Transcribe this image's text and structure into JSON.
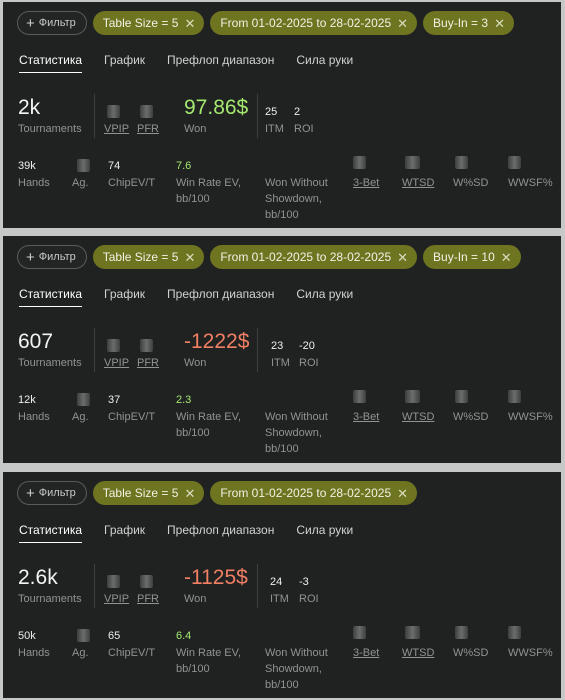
{
  "panels": [
    {
      "filter_label": "Фильтр",
      "chips": [
        "Table Size = 5",
        "From 01-02-2025 to 28-02-2025",
        "Buy-In = 3"
      ],
      "tabs": [
        "Статистика",
        "График",
        "Префлоп диапазон",
        "Сила руки"
      ],
      "tournaments": {
        "value": "2k",
        "label": "Tournaments"
      },
      "vpip_label": "VPIP",
      "pfr_label": "PFR",
      "won": {
        "value": "97.86$",
        "label": "Won",
        "sign": "positive"
      },
      "itm": {
        "value": "25",
        "label": "ITM"
      },
      "roi": {
        "value": "2",
        "label": "ROI"
      },
      "hands": {
        "value": "39k",
        "label": "Hands"
      },
      "ag_label": "Ag.",
      "chipev": {
        "value": "74",
        "label": "ChipEV/T"
      },
      "winrate": {
        "value": "7.6",
        "label_line1": "Win Rate EV,",
        "label_line2": "bb/100"
      },
      "won_without": {
        "line1": "Won Without",
        "line2": "Showdown,",
        "line3": "bb/100"
      },
      "threebet_label": "3-Bet",
      "wtsd_label": "WTSD",
      "wsd_label": "W%SD",
      "wwsf_label": "WWSF%"
    },
    {
      "filter_label": "Фильтр",
      "chips": [
        "Table Size = 5",
        "From 01-02-2025 to 28-02-2025",
        "Buy-In = 10"
      ],
      "tabs": [
        "Статистика",
        "График",
        "Префлоп диапазон",
        "Сила руки"
      ],
      "tournaments": {
        "value": "607",
        "label": "Tournaments"
      },
      "vpip_label": "VPIP",
      "pfr_label": "PFR",
      "won": {
        "value": "-1222$",
        "label": "Won",
        "sign": "negative"
      },
      "itm": {
        "value": "23",
        "label": "ITM"
      },
      "roi": {
        "value": "-20",
        "label": "ROI"
      },
      "hands": {
        "value": "12k",
        "label": "Hands"
      },
      "ag_label": "Ag.",
      "chipev": {
        "value": "37",
        "label": "ChipEV/T"
      },
      "winrate": {
        "value": "2.3",
        "label_line1": "Win Rate EV,",
        "label_line2": "bb/100"
      },
      "won_without": {
        "line1": "Won Without",
        "line2": "Showdown,",
        "line3": "bb/100"
      },
      "threebet_label": "3-Bet",
      "wtsd_label": "WTSD",
      "wsd_label": "W%SD",
      "wwsf_label": "WWSF%"
    },
    {
      "filter_label": "Фильтр",
      "chips": [
        "Table Size = 5",
        "From 01-02-2025 to 28-02-2025"
      ],
      "tabs": [
        "Статистика",
        "График",
        "Префлоп диапазон",
        "Сила руки"
      ],
      "tournaments": {
        "value": "2.6k",
        "label": "Tournaments"
      },
      "vpip_label": "VPIP",
      "pfr_label": "PFR",
      "won": {
        "value": "-1125$",
        "label": "Won",
        "sign": "negative"
      },
      "itm": {
        "value": "24",
        "label": "ITM"
      },
      "roi": {
        "value": "-3",
        "label": "ROI"
      },
      "hands": {
        "value": "50k",
        "label": "Hands"
      },
      "ag_label": "Ag.",
      "chipev": {
        "value": "65",
        "label": "ChipEV/T"
      },
      "winrate": {
        "value": "6.4",
        "label_line1": "Win Rate EV,",
        "label_line2": "bb/100"
      },
      "won_without": {
        "line1": "Won Without",
        "line2": "Showdown,",
        "line3": "bb/100"
      },
      "threebet_label": "3-Bet",
      "wtsd_label": "WTSD",
      "wsd_label": "W%SD",
      "wwsf_label": "WWSF%"
    }
  ],
  "colors": {
    "chip_bg": "#6e7420",
    "positive": "#a5e86f",
    "negative": "#f07f64",
    "panel_bg": "#1f2221"
  }
}
